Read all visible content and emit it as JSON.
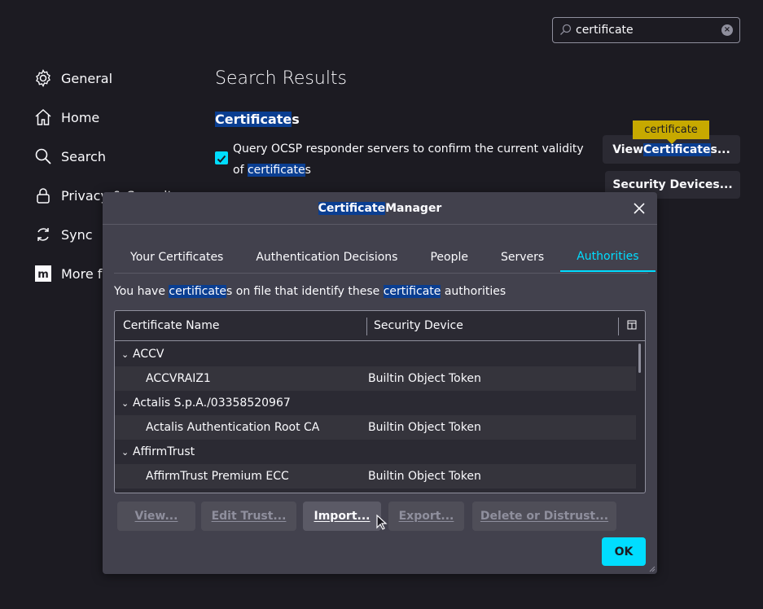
{
  "search": {
    "value": "certificate",
    "clear_icon": "clear-icon"
  },
  "sidebar": {
    "items": [
      {
        "label": "General",
        "icon": "gear-icon"
      },
      {
        "label": "Home",
        "icon": "home-icon"
      },
      {
        "label": "Search",
        "icon": "search-icon"
      },
      {
        "label": "Privacy & Security",
        "icon": "lock-icon"
      },
      {
        "label": "Sync",
        "icon": "sync-icon"
      },
      {
        "label": "More from Mozilla",
        "icon": "mozilla-icon"
      }
    ]
  },
  "main": {
    "title": "Search Results",
    "section": {
      "title_hl": "Certificate",
      "title_rest": "s"
    },
    "ocsp": {
      "line1": "Query OCSP responder servers to confirm the current validity of ",
      "hl": "certificate",
      "rest": "s"
    },
    "tooltip": "certificate",
    "view_btn": {
      "pre": "View ",
      "hl": "Certificate",
      "post": "s..."
    },
    "security_devices_btn": "Security Devices..."
  },
  "dialog": {
    "title_hl": "Certificate",
    "title_rest": " Manager",
    "tabs": [
      "Your Certificates",
      "Authentication Decisions",
      "People",
      "Servers",
      "Authorities"
    ],
    "active_tab": "Authorities",
    "desc": {
      "pre": "You have ",
      "hl1": "certificate",
      "mid1": "s on file that identify these ",
      "hl2": "certificate",
      "post": " authorities"
    },
    "columns": {
      "name": "Certificate Name",
      "device": "Security Device"
    },
    "rows": [
      {
        "name": "ACCV",
        "device": "",
        "group": true
      },
      {
        "name": "ACCVRAIZ1",
        "device": "Builtin Object Token",
        "group": false
      },
      {
        "name": "Actalis S.p.A./03358520967",
        "device": "",
        "group": true
      },
      {
        "name": "Actalis Authentication Root CA",
        "device": "Builtin Object Token",
        "group": false
      },
      {
        "name": "AffirmTrust",
        "device": "",
        "group": true
      },
      {
        "name": "AffirmTrust Premium ECC",
        "device": "Builtin Object Token",
        "group": false
      }
    ],
    "buttons": {
      "view": "View...",
      "edit_trust": "Edit Trust...",
      "import": "Import...",
      "export": "Export...",
      "delete": "Delete or Distrust..."
    },
    "ok": "OK"
  },
  "colors": {
    "accent": "#00ddff",
    "highlight": "#0a3e91",
    "tooltip": "#c7a900"
  }
}
